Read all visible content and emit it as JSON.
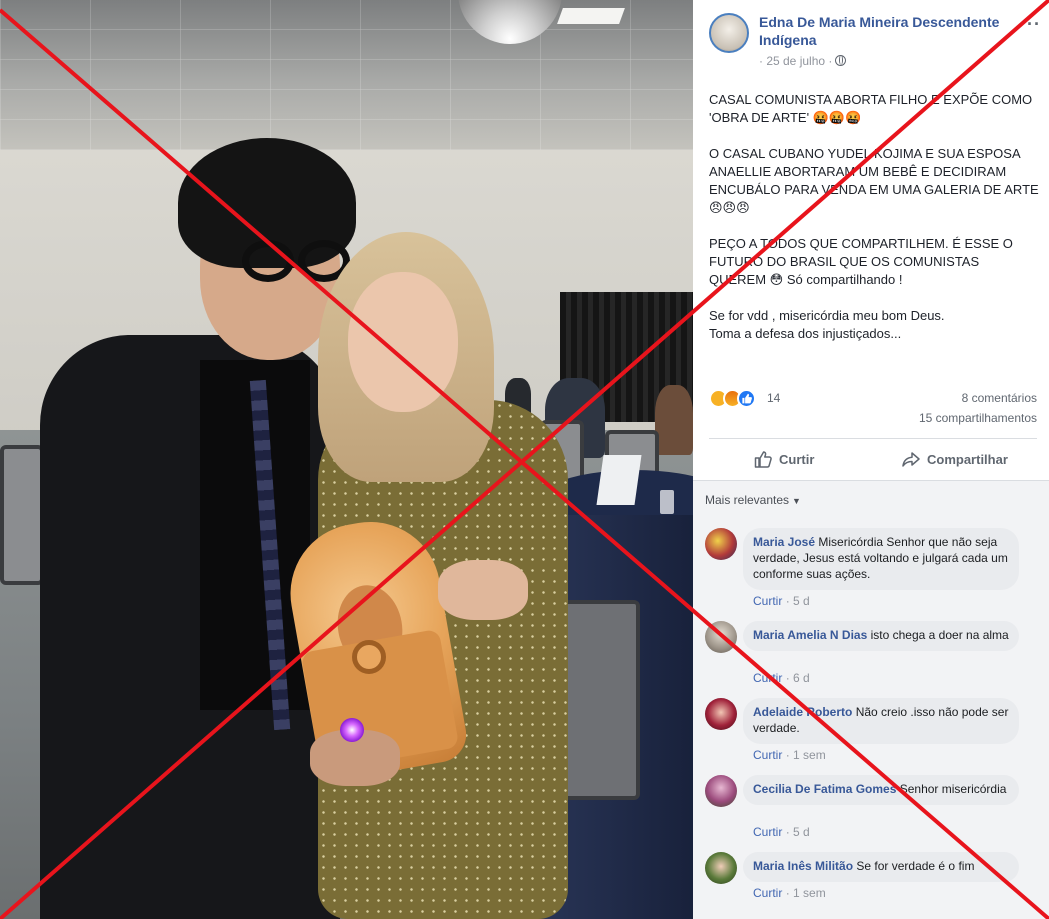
{
  "post": {
    "author": "Edna De Maria Mineira Descendente Indígena",
    "date": "· 25 de julho ·",
    "more": "··",
    "paragraphs": [
      "CASAL COMUNISTA ABORTA FILHO E EXPÕE COMO 'OBRA DE ARTE' 🤬🤬🤬",
      "O CASAL CUBANO YUDEL KOJIMA E SUA ESPOSA ANAELLIE ABORTARAM UM BEBÊ E DECIDIRAM ENCUBÁLO PARA VENDA EM UMA GALERIA DE ARTE 😠😠😠",
      "PEÇO A TODOS QUE COMPARTILHEM. É ESSE O FUTURO DO BRASIL QUE OS COMUNISTAS QUEREM 😳 Só compartilhando !",
      "Se for vdd , misericórdia meu bom Deus.",
      "Toma a defesa dos injustiçados..."
    ]
  },
  "stats": {
    "reaction_count": "14",
    "comments": "8 comentários",
    "shares": "15 compartilhamentos"
  },
  "actions": {
    "like": "Curtir",
    "share": "Compartilhar"
  },
  "comments_header": {
    "sort": "Mais relevantes"
  },
  "comments": [
    {
      "name": "Maria José",
      "text": "Misericórdia Senhor que não seja verdade, Jesus está voltando e julgará cada um conforme suas ações.",
      "reply": "Curtir",
      "time": "· 5 d"
    },
    {
      "name": "Maria Amelia N Dias",
      "text": "isto chega a doer na alma",
      "reply": "Curtir",
      "time": "· 6 d"
    },
    {
      "name": "Adelaide Roberto",
      "text": "Não creio .isso não pode ser verdade.",
      "reply": "Curtir",
      "time": "· 1 sem"
    },
    {
      "name": "Cecilia De Fatima Gomes",
      "text": "Senhor misericórdia",
      "reply": "Curtir",
      "time": "· 5 d"
    },
    {
      "name": "Maria Inês Militão",
      "text": "Se for verdade é o fim",
      "reply": "Curtir",
      "time": "· 1 sem"
    }
  ],
  "colors": {
    "link_blue": "#385898",
    "cross_red": "#e8141c",
    "comment_bg": "#f2f3f5"
  },
  "icons": [
    "globe-icon",
    "thumbs-up-icon",
    "share-arrow-icon",
    "more-icon",
    "sad-reaction-icon",
    "angry-reaction-icon",
    "like-reaction-icon"
  ]
}
